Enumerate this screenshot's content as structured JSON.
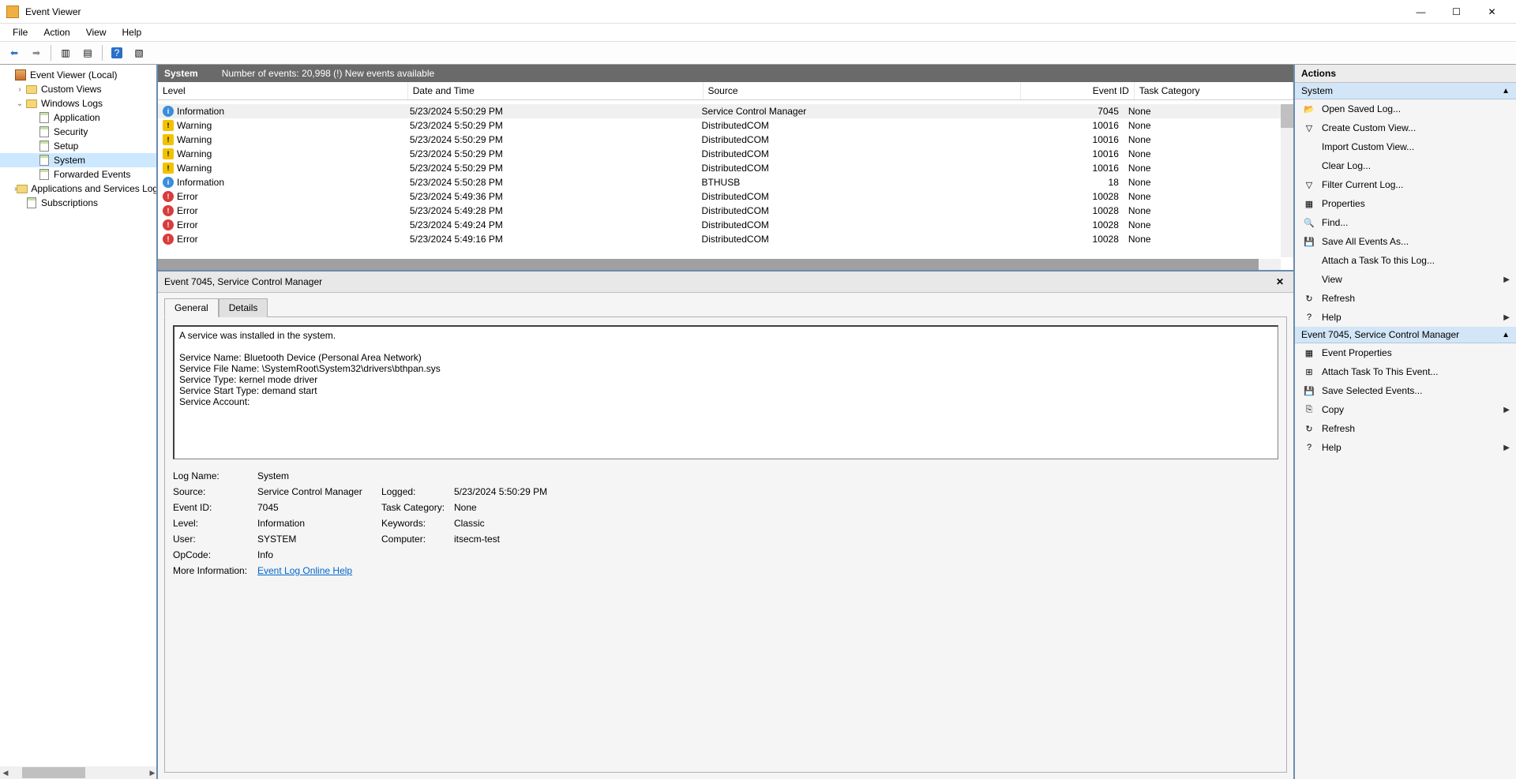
{
  "window": {
    "title": "Event Viewer"
  },
  "menu": {
    "file": "File",
    "action": "Action",
    "view": "View",
    "help": "Help"
  },
  "tree": {
    "root": "Event Viewer (Local)",
    "custom_views": "Custom Views",
    "windows_logs": "Windows Logs",
    "logs": {
      "application": "Application",
      "security": "Security",
      "setup": "Setup",
      "system": "System",
      "forwarded": "Forwarded Events"
    },
    "app_services": "Applications and Services Logs",
    "subscriptions": "Subscriptions"
  },
  "center": {
    "log_name": "System",
    "count_text": "Number of events: 20,998 (!) New events available",
    "columns": {
      "level": "Level",
      "datetime": "Date and Time",
      "source": "Source",
      "eventid": "Event ID",
      "category": "Task Category"
    },
    "rows": [
      {
        "level": "Information",
        "icon": "info",
        "datetime": "5/23/2024 5:50:29 PM",
        "source": "Service Control Manager",
        "eventid": "7045",
        "category": "None"
      },
      {
        "level": "Warning",
        "icon": "warn",
        "datetime": "5/23/2024 5:50:29 PM",
        "source": "DistributedCOM",
        "eventid": "10016",
        "category": "None"
      },
      {
        "level": "Warning",
        "icon": "warn",
        "datetime": "5/23/2024 5:50:29 PM",
        "source": "DistributedCOM",
        "eventid": "10016",
        "category": "None"
      },
      {
        "level": "Warning",
        "icon": "warn",
        "datetime": "5/23/2024 5:50:29 PM",
        "source": "DistributedCOM",
        "eventid": "10016",
        "category": "None"
      },
      {
        "level": "Warning",
        "icon": "warn",
        "datetime": "5/23/2024 5:50:29 PM",
        "source": "DistributedCOM",
        "eventid": "10016",
        "category": "None"
      },
      {
        "level": "Information",
        "icon": "info",
        "datetime": "5/23/2024 5:50:28 PM",
        "source": "BTHUSB",
        "eventid": "18",
        "category": "None"
      },
      {
        "level": "Error",
        "icon": "err",
        "datetime": "5/23/2024 5:49:36 PM",
        "source": "DistributedCOM",
        "eventid": "10028",
        "category": "None"
      },
      {
        "level": "Error",
        "icon": "err",
        "datetime": "5/23/2024 5:49:28 PM",
        "source": "DistributedCOM",
        "eventid": "10028",
        "category": "None"
      },
      {
        "level": "Error",
        "icon": "err",
        "datetime": "5/23/2024 5:49:24 PM",
        "source": "DistributedCOM",
        "eventid": "10028",
        "category": "None"
      },
      {
        "level": "Error",
        "icon": "err",
        "datetime": "5/23/2024 5:49:16 PM",
        "source": "DistributedCOM",
        "eventid": "10028",
        "category": "None"
      }
    ]
  },
  "detail": {
    "header": "Event 7045, Service Control Manager",
    "tabs": {
      "general": "General",
      "details": "Details"
    },
    "description": "A service was installed in the system.\n\nService Name:  Bluetooth Device (Personal Area Network)\nService File Name:  \\SystemRoot\\System32\\drivers\\bthpan.sys\nService Type:  kernel mode driver\nService Start Type:  demand start\nService Account:",
    "fields": {
      "log_name_l": "Log Name:",
      "log_name_v": "System",
      "source_l": "Source:",
      "source_v": "Service Control Manager",
      "logged_l": "Logged:",
      "logged_v": "5/23/2024 5:50:29 PM",
      "eventid_l": "Event ID:",
      "eventid_v": "7045",
      "taskcat_l": "Task Category:",
      "taskcat_v": "None",
      "level_l": "Level:",
      "level_v": "Information",
      "keywords_l": "Keywords:",
      "keywords_v": "Classic",
      "user_l": "User:",
      "user_v": "SYSTEM",
      "computer_l": "Computer:",
      "computer_v": "itsecm-test",
      "opcode_l": "OpCode:",
      "opcode_v": "Info",
      "moreinfo_l": "More Information:",
      "moreinfo_link": "Event Log Online Help"
    }
  },
  "actions": {
    "title": "Actions",
    "section_system": "System",
    "section_event": "Event 7045, Service Control Manager",
    "items_system": [
      {
        "label": "Open Saved Log...",
        "icon": "📂"
      },
      {
        "label": "Create Custom View...",
        "icon": "▽"
      },
      {
        "label": "Import Custom View...",
        "icon": ""
      },
      {
        "label": "Clear Log...",
        "icon": ""
      },
      {
        "label": "Filter Current Log...",
        "icon": "▽"
      },
      {
        "label": "Properties",
        "icon": "▦"
      },
      {
        "label": "Find...",
        "icon": "🔍"
      },
      {
        "label": "Save All Events As...",
        "icon": "💾"
      },
      {
        "label": "Attach a Task To this Log...",
        "icon": ""
      },
      {
        "label": "View",
        "icon": "",
        "arrow": true
      },
      {
        "label": "Refresh",
        "icon": "↻"
      },
      {
        "label": "Help",
        "icon": "?",
        "arrow": true
      }
    ],
    "items_event": [
      {
        "label": "Event Properties",
        "icon": "▦"
      },
      {
        "label": "Attach Task To This Event...",
        "icon": "⊞"
      },
      {
        "label": "Save Selected Events...",
        "icon": "💾"
      },
      {
        "label": "Copy",
        "icon": "⎘",
        "arrow": true
      },
      {
        "label": "Refresh",
        "icon": "↻"
      },
      {
        "label": "Help",
        "icon": "?",
        "arrow": true
      }
    ]
  }
}
